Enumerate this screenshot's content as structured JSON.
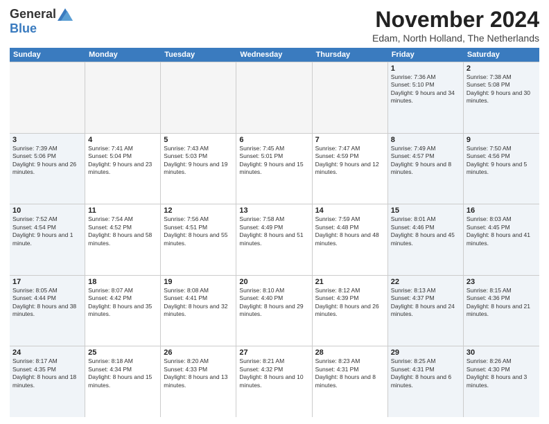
{
  "logo": {
    "general": "General",
    "blue": "Blue"
  },
  "title": {
    "month": "November 2024",
    "location": "Edam, North Holland, The Netherlands"
  },
  "header_days": [
    "Sunday",
    "Monday",
    "Tuesday",
    "Wednesday",
    "Thursday",
    "Friday",
    "Saturday"
  ],
  "weeks": [
    [
      {
        "day": "",
        "info": "",
        "empty": true
      },
      {
        "day": "",
        "info": "",
        "empty": true
      },
      {
        "day": "",
        "info": "",
        "empty": true
      },
      {
        "day": "",
        "info": "",
        "empty": true
      },
      {
        "day": "",
        "info": "",
        "empty": true
      },
      {
        "day": "1",
        "info": "Sunrise: 7:36 AM\nSunset: 5:10 PM\nDaylight: 9 hours and 34 minutes.",
        "empty": false,
        "weekend": true
      },
      {
        "day": "2",
        "info": "Sunrise: 7:38 AM\nSunset: 5:08 PM\nDaylight: 9 hours and 30 minutes.",
        "empty": false,
        "weekend": true
      }
    ],
    [
      {
        "day": "3",
        "info": "Sunrise: 7:39 AM\nSunset: 5:06 PM\nDaylight: 9 hours and 26 minutes.",
        "empty": false,
        "weekend": true
      },
      {
        "day": "4",
        "info": "Sunrise: 7:41 AM\nSunset: 5:04 PM\nDaylight: 9 hours and 23 minutes.",
        "empty": false
      },
      {
        "day": "5",
        "info": "Sunrise: 7:43 AM\nSunset: 5:03 PM\nDaylight: 9 hours and 19 minutes.",
        "empty": false
      },
      {
        "day": "6",
        "info": "Sunrise: 7:45 AM\nSunset: 5:01 PM\nDaylight: 9 hours and 15 minutes.",
        "empty": false
      },
      {
        "day": "7",
        "info": "Sunrise: 7:47 AM\nSunset: 4:59 PM\nDaylight: 9 hours and 12 minutes.",
        "empty": false
      },
      {
        "day": "8",
        "info": "Sunrise: 7:49 AM\nSunset: 4:57 PM\nDaylight: 9 hours and 8 minutes.",
        "empty": false,
        "weekend": true
      },
      {
        "day": "9",
        "info": "Sunrise: 7:50 AM\nSunset: 4:56 PM\nDaylight: 9 hours and 5 minutes.",
        "empty": false,
        "weekend": true
      }
    ],
    [
      {
        "day": "10",
        "info": "Sunrise: 7:52 AM\nSunset: 4:54 PM\nDaylight: 9 hours and 1 minute.",
        "empty": false,
        "weekend": true
      },
      {
        "day": "11",
        "info": "Sunrise: 7:54 AM\nSunset: 4:52 PM\nDaylight: 8 hours and 58 minutes.",
        "empty": false
      },
      {
        "day": "12",
        "info": "Sunrise: 7:56 AM\nSunset: 4:51 PM\nDaylight: 8 hours and 55 minutes.",
        "empty": false
      },
      {
        "day": "13",
        "info": "Sunrise: 7:58 AM\nSunset: 4:49 PM\nDaylight: 8 hours and 51 minutes.",
        "empty": false
      },
      {
        "day": "14",
        "info": "Sunrise: 7:59 AM\nSunset: 4:48 PM\nDaylight: 8 hours and 48 minutes.",
        "empty": false
      },
      {
        "day": "15",
        "info": "Sunrise: 8:01 AM\nSunset: 4:46 PM\nDaylight: 8 hours and 45 minutes.",
        "empty": false,
        "weekend": true
      },
      {
        "day": "16",
        "info": "Sunrise: 8:03 AM\nSunset: 4:45 PM\nDaylight: 8 hours and 41 minutes.",
        "empty": false,
        "weekend": true
      }
    ],
    [
      {
        "day": "17",
        "info": "Sunrise: 8:05 AM\nSunset: 4:44 PM\nDaylight: 8 hours and 38 minutes.",
        "empty": false,
        "weekend": true
      },
      {
        "day": "18",
        "info": "Sunrise: 8:07 AM\nSunset: 4:42 PM\nDaylight: 8 hours and 35 minutes.",
        "empty": false
      },
      {
        "day": "19",
        "info": "Sunrise: 8:08 AM\nSunset: 4:41 PM\nDaylight: 8 hours and 32 minutes.",
        "empty": false
      },
      {
        "day": "20",
        "info": "Sunrise: 8:10 AM\nSunset: 4:40 PM\nDaylight: 8 hours and 29 minutes.",
        "empty": false
      },
      {
        "day": "21",
        "info": "Sunrise: 8:12 AM\nSunset: 4:39 PM\nDaylight: 8 hours and 26 minutes.",
        "empty": false
      },
      {
        "day": "22",
        "info": "Sunrise: 8:13 AM\nSunset: 4:37 PM\nDaylight: 8 hours and 24 minutes.",
        "empty": false,
        "weekend": true
      },
      {
        "day": "23",
        "info": "Sunrise: 8:15 AM\nSunset: 4:36 PM\nDaylight: 8 hours and 21 minutes.",
        "empty": false,
        "weekend": true
      }
    ],
    [
      {
        "day": "24",
        "info": "Sunrise: 8:17 AM\nSunset: 4:35 PM\nDaylight: 8 hours and 18 minutes.",
        "empty": false,
        "weekend": true
      },
      {
        "day": "25",
        "info": "Sunrise: 8:18 AM\nSunset: 4:34 PM\nDaylight: 8 hours and 15 minutes.",
        "empty": false
      },
      {
        "day": "26",
        "info": "Sunrise: 8:20 AM\nSunset: 4:33 PM\nDaylight: 8 hours and 13 minutes.",
        "empty": false
      },
      {
        "day": "27",
        "info": "Sunrise: 8:21 AM\nSunset: 4:32 PM\nDaylight: 8 hours and 10 minutes.",
        "empty": false
      },
      {
        "day": "28",
        "info": "Sunrise: 8:23 AM\nSunset: 4:31 PM\nDaylight: 8 hours and 8 minutes.",
        "empty": false
      },
      {
        "day": "29",
        "info": "Sunrise: 8:25 AM\nSunset: 4:31 PM\nDaylight: 8 hours and 6 minutes.",
        "empty": false,
        "weekend": true
      },
      {
        "day": "30",
        "info": "Sunrise: 8:26 AM\nSunset: 4:30 PM\nDaylight: 8 hours and 3 minutes.",
        "empty": false,
        "weekend": true
      }
    ]
  ]
}
